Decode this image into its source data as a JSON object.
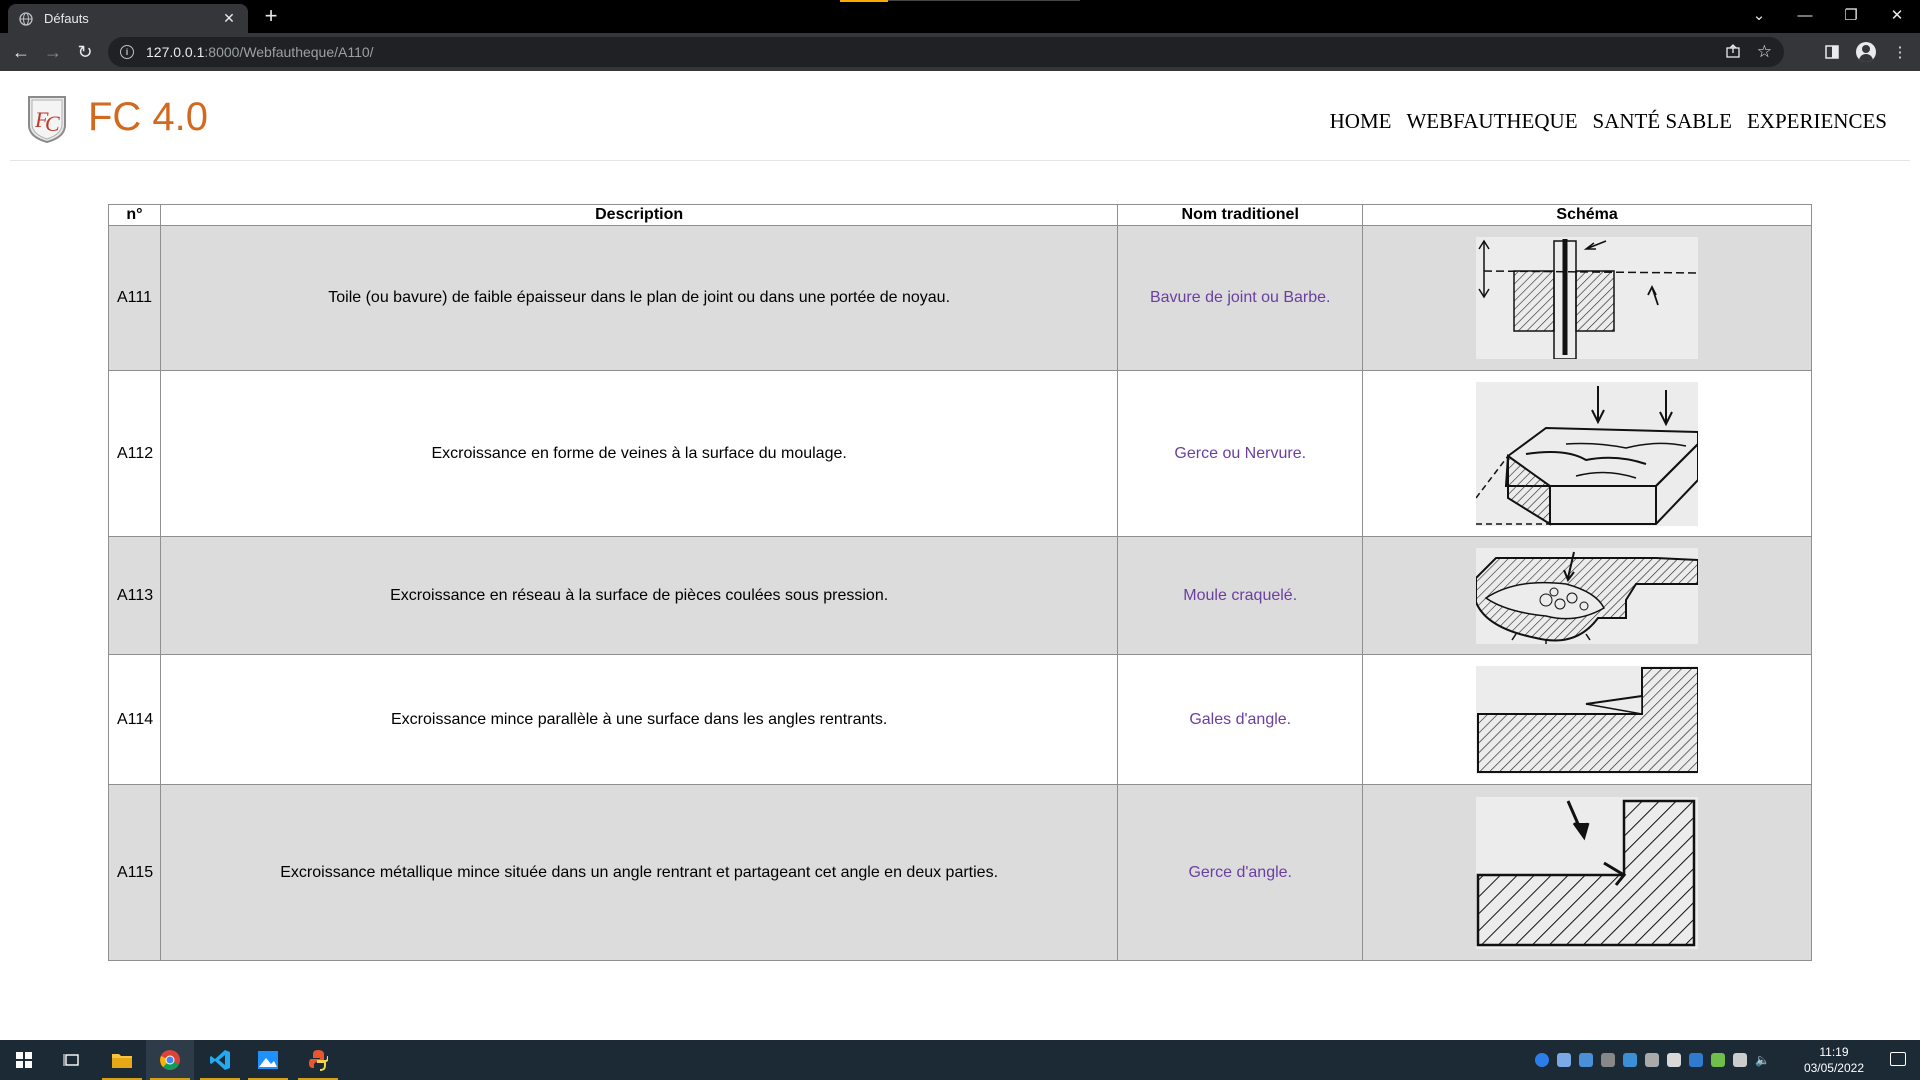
{
  "browser": {
    "tab_title": "Défauts",
    "tab_close": "✕",
    "new_tab": "+",
    "url_host": "127.0.0.1",
    "url_rest": ":8000/Webfautheque/A110/"
  },
  "site": {
    "brand": "FC 4.0",
    "nav": [
      "HOME",
      "WEBFAUTHEQUE",
      "SANTÉ SABLE",
      "EXPERIENCES"
    ]
  },
  "table": {
    "headers": [
      "n°",
      "Description",
      "Nom traditionel",
      "Schéma"
    ],
    "rows": [
      {
        "num": "A111",
        "description": "Toile (ou bavure) de faible épaisseur dans le plan de joint ou dans une portée de noyau.",
        "name": "Bavure de joint ou Barbe."
      },
      {
        "num": "A112",
        "description": "Excroissance en forme de veines à la surface du moulage.",
        "name": "Gerce ou Nervure."
      },
      {
        "num": "A113",
        "description": "Excroissance en réseau à la surface de pièces coulées sous pression.",
        "name": "Moule craquelé."
      },
      {
        "num": "A114",
        "description": "Excroissance mince parallèle à une surface dans les angles rentrants.",
        "name": "Gales d'angle."
      },
      {
        "num": "A115",
        "description": "Excroissance métallique mince située dans un angle rentrant et partageant cet angle en deux parties.",
        "name": "Gerce d'angle."
      }
    ]
  },
  "taskbar": {
    "time": "11:19",
    "date": "03/05/2022"
  }
}
